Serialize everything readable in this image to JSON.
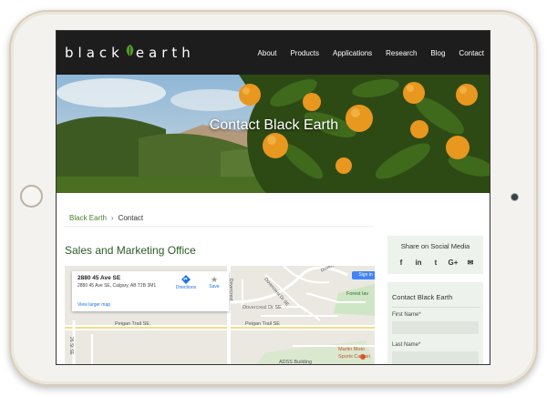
{
  "brand": {
    "logo_text_left": "black",
    "logo_text_right": "earth",
    "leaf_color": "#4f9a2a"
  },
  "nav": {
    "items": [
      "About",
      "Products",
      "Applications",
      "Research",
      "Blog",
      "Contact"
    ]
  },
  "hero": {
    "title": "Contact Black Earth"
  },
  "breadcrumb": {
    "home": "Black Earth",
    "separator": "›",
    "current": "Contact"
  },
  "main": {
    "section_title": "Sales and Marketing Office"
  },
  "map": {
    "address_title": "2880 45 Ave SE",
    "address_full": "2880 45 Ave SE, Calgary, AB T2B 3M1",
    "directions_label": "Directions",
    "save_label": "Save",
    "larger_map": "View larger map",
    "signin_label": "Sign in",
    "streets": [
      "Dovercrest Dr SE",
      "Peigan Trail SE",
      "Peigan Trail SE",
      "Forest lav",
      "26 St SE",
      "Dovercrest Dr SE",
      "Dovercrest",
      "Dovercrest"
    ],
    "places": [
      "ADSS Building",
      "Martin Moto",
      "Sports Calgari"
    ]
  },
  "share": {
    "title": "Share on Social Media",
    "icons": [
      "facebook-icon",
      "linkedin-icon",
      "twitter-icon",
      "google-plus-icon",
      "email-icon"
    ],
    "glyphs": [
      "f",
      "in",
      "t",
      "G+",
      "✉"
    ]
  },
  "form": {
    "title": "Contact Black Earth",
    "first_name_label": "First Name*",
    "last_name_label": "Last Name*"
  }
}
